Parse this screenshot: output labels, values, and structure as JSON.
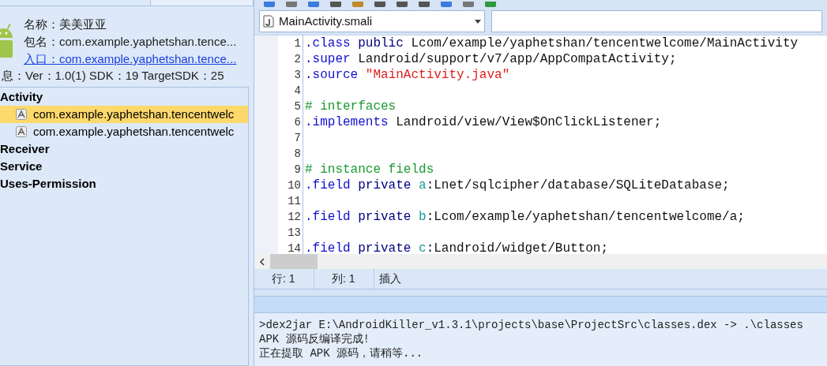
{
  "app_info": {
    "name_label": "名称：",
    "name": "美美亚亚",
    "package_label": "包名：",
    "package": "com.example.yaphetshan.tence...",
    "entry": "入口：com.example.yaphetshan.tence...",
    "info": "息：Ver：1.0(1) SDK：19 TargetSDK：25"
  },
  "tree": [
    {
      "label": "Activity",
      "children": [
        {
          "label": "com.example.yaphetshan.tencentwelc",
          "selected": true
        },
        {
          "label": "com.example.yaphetshan.tencentwelc",
          "selected": false
        }
      ]
    },
    {
      "label": "Receiver"
    },
    {
      "label": "Service"
    },
    {
      "label": "Uses-Permission"
    }
  ],
  "file_selector": {
    "value": "MainActivity.smali"
  },
  "code_lines": [
    {
      "number": "1",
      "tokens": [
        {
          "kind": "directive",
          "text": ".class"
        },
        {
          "kind": "keyword",
          "text": " public"
        },
        {
          "kind": "plain",
          "text": " Lcom/example/yaphetshan/tencentwelcome/MainActivity"
        }
      ]
    },
    {
      "number": "2",
      "tokens": [
        {
          "kind": "directive",
          "text": ".super"
        },
        {
          "kind": "plain",
          "text": " Landroid/support/v7/app/AppCompatActivity;"
        }
      ]
    },
    {
      "number": "3",
      "tokens": [
        {
          "kind": "directive",
          "text": ".source"
        },
        {
          "kind": "string",
          "text": " \"MainActivity.java\""
        }
      ]
    },
    {
      "number": "4"
    },
    {
      "number": "5",
      "tokens": [
        {
          "kind": "comment",
          "text": "# interfaces"
        }
      ]
    },
    {
      "number": "6",
      "tokens": [
        {
          "kind": "directive",
          "text": ".implements"
        },
        {
          "kind": "plain",
          "text": " Landroid/view/View$OnClickListener;"
        }
      ]
    },
    {
      "number": "7"
    },
    {
      "number": "8"
    },
    {
      "number": "9",
      "tokens": [
        {
          "kind": "comment",
          "text": "# instance fields"
        }
      ]
    },
    {
      "number": "10",
      "tokens": [
        {
          "kind": "directive",
          "text": ".field"
        },
        {
          "kind": "keyword",
          "text": " private"
        },
        {
          "kind": "field",
          "text": " a"
        },
        {
          "kind": "plain",
          "text": ":Lnet/sqlcipher/database/SQLiteDatabase;"
        }
      ]
    },
    {
      "number": "11"
    },
    {
      "number": "12",
      "tokens": [
        {
          "kind": "directive",
          "text": ".field"
        },
        {
          "kind": "keyword",
          "text": " private"
        },
        {
          "kind": "field",
          "text": " b"
        },
        {
          "kind": "plain",
          "text": ":Lcom/example/yaphetshan/tencentwelcome/a;"
        }
      ]
    },
    {
      "number": "13"
    },
    {
      "number": "14",
      "tokens": [
        {
          "kind": "directive",
          "text": ".field"
        },
        {
          "kind": "keyword",
          "text": " private"
        },
        {
          "kind": "field",
          "text": " c"
        },
        {
          "kind": "plain",
          "text": ":Landroid/widget/Button;"
        }
      ]
    }
  ],
  "status_bar": [
    {
      "text": "行: 1"
    },
    {
      "text": "列: 1"
    },
    {
      "text": "插入"
    }
  ],
  "console_lines": [
    ">dex2jar E:\\AndroidKiller_v1.3.1\\projects\\base\\ProjectSrc\\classes.dex -> .\\classes",
    "APK 源码反编译完成!",
    "正在提取 APK 源码，请稍等..."
  ]
}
